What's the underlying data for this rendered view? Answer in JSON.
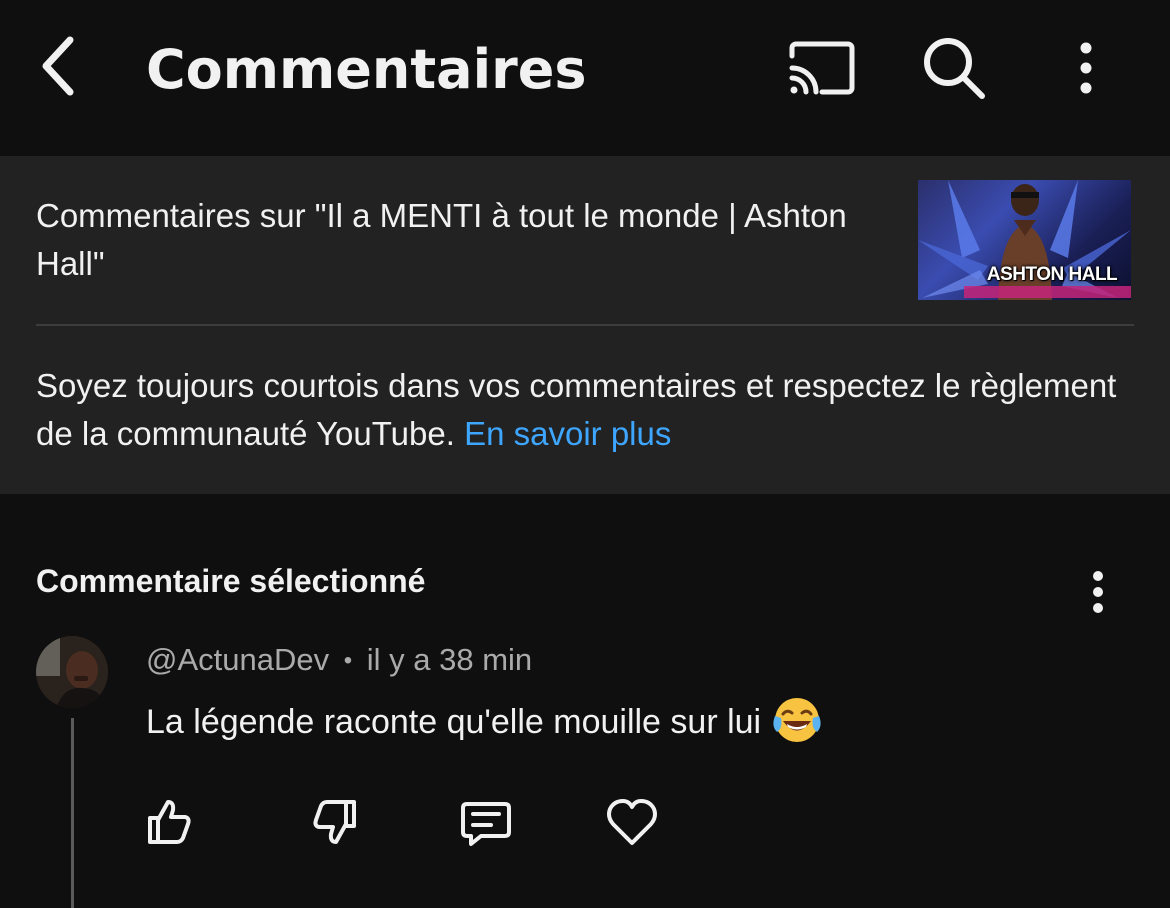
{
  "app_bar": {
    "title": "Commentaires",
    "icons": [
      "back-icon",
      "cast-icon",
      "search-icon",
      "more-vert-icon"
    ]
  },
  "header": {
    "video_title": "Commentaires sur \"Il a MENTI à tout le monde | Ashton Hall\"",
    "thumbnail_text": "ASHTON HALL",
    "guidelines_text": "Soyez toujours courtois dans vos commentaires et respectez le règlement de la communauté YouTube.",
    "learn_more": "En savoir plus"
  },
  "selected_comment": {
    "section_title": "Commentaire sélectionné",
    "author": "@ActunaDev",
    "separator": "•",
    "time": "il y a 38 min",
    "text": "La légende raconte qu'elle mouille sur lui",
    "emoji": "face-with-tears-of-joy-icon",
    "actions": [
      "like-icon",
      "dislike-icon",
      "reply-icon",
      "heart-icon"
    ]
  },
  "colors": {
    "background": "#0f0f0f",
    "panel": "#222222",
    "text": "#f1f1f1",
    "secondary_text": "#aaaaaa",
    "link": "#3ea6ff"
  }
}
